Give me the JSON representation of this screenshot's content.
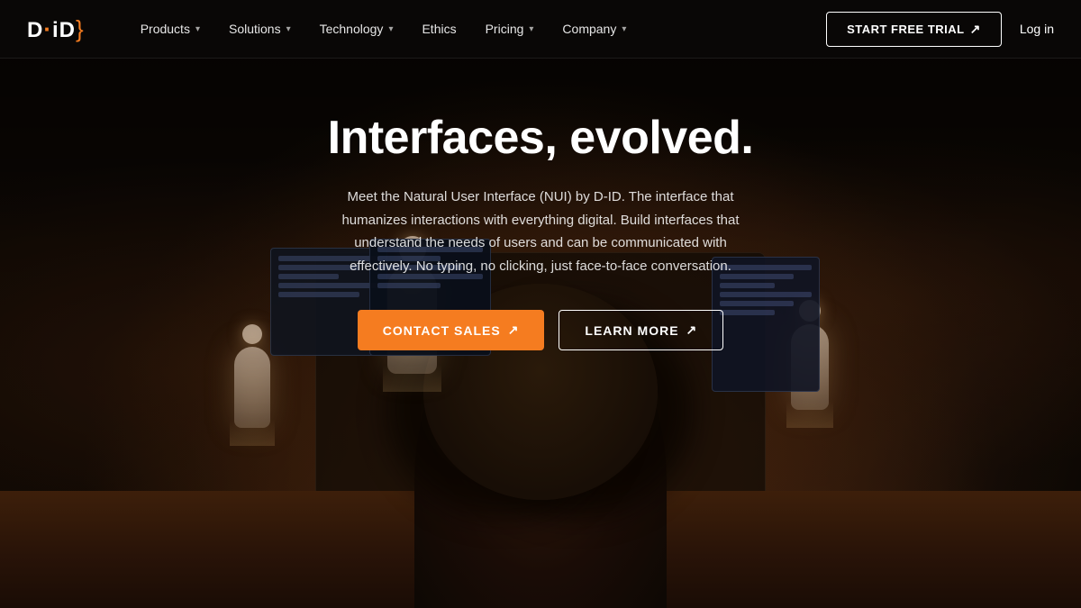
{
  "brand": {
    "name": "D·iD",
    "logo_d": "D",
    "logo_separator": "·",
    "logo_id": "iD",
    "logo_bracket": "}"
  },
  "nav": {
    "items": [
      {
        "label": "Products",
        "has_dropdown": true
      },
      {
        "label": "Solutions",
        "has_dropdown": true
      },
      {
        "label": "Technology",
        "has_dropdown": true
      },
      {
        "label": "Ethics",
        "has_dropdown": false
      },
      {
        "label": "Pricing",
        "has_dropdown": true
      },
      {
        "label": "Company",
        "has_dropdown": true
      }
    ],
    "trial_button": "START FREE TRIAL",
    "trial_arrow": "↗",
    "login_label": "Log in"
  },
  "hero": {
    "title": "Interfaces, evolved.",
    "subtitle": "Meet the Natural User Interface (NUI) by D-ID. The interface that humanizes interactions with everything digital. Build interfaces that understand the needs of users and can be communicated with effectively. No typing, no clicking, just face-to-face conversation.",
    "contact_button": "CONTACT SALES",
    "contact_arrow": "↗",
    "learn_button": "LEARN MORE",
    "learn_arrow": "↗"
  },
  "colors": {
    "accent": "#f57c20",
    "background": "#0d0804",
    "nav_bg": "rgba(10,8,6,0.92)",
    "text_primary": "#ffffff",
    "text_secondary": "rgba(255,255,255,0.85)"
  }
}
